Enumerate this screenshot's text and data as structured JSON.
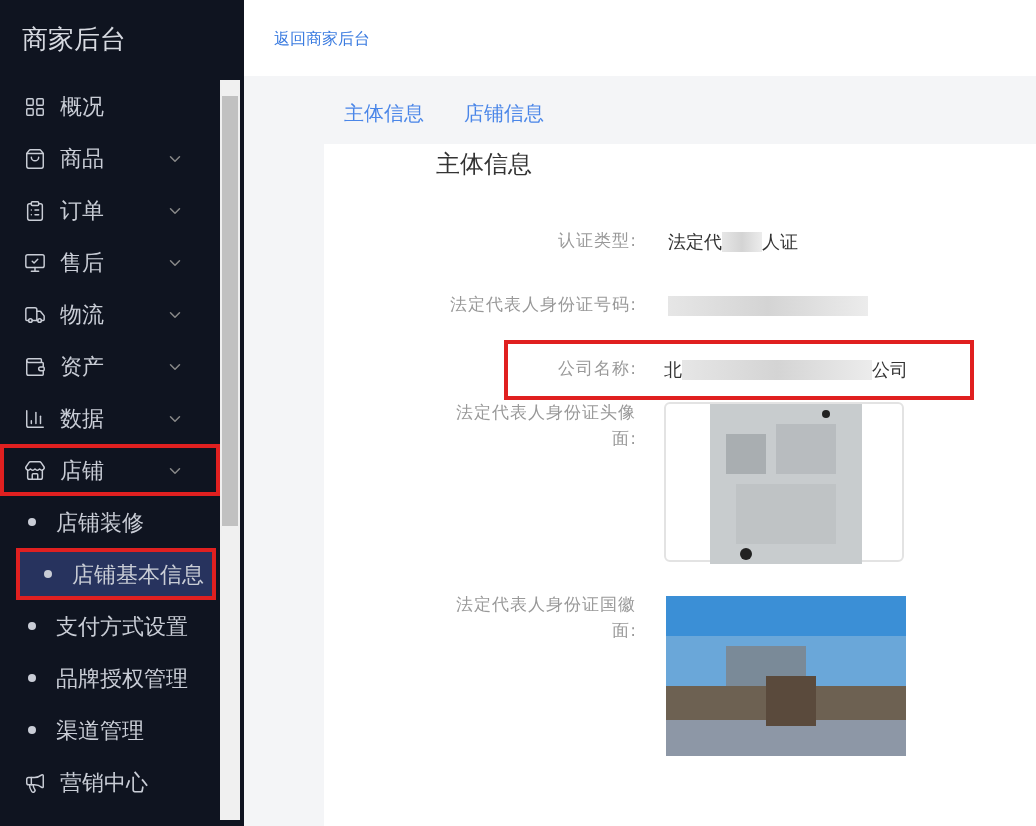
{
  "sidebar": {
    "title": "商家后台",
    "items": [
      {
        "label": "概况",
        "expandable": false,
        "highlighted": false
      },
      {
        "label": "商品",
        "expandable": true,
        "highlighted": false
      },
      {
        "label": "订单",
        "expandable": true,
        "highlighted": false
      },
      {
        "label": "售后",
        "expandable": true,
        "highlighted": false
      },
      {
        "label": "物流",
        "expandable": true,
        "highlighted": false
      },
      {
        "label": "资产",
        "expandable": true,
        "highlighted": false
      },
      {
        "label": "数据",
        "expandable": true,
        "highlighted": false
      },
      {
        "label": "店铺",
        "expandable": true,
        "highlighted": true,
        "children": [
          {
            "label": "店铺装修",
            "selected": false,
            "highlighted": false
          },
          {
            "label": "店铺基本信息",
            "selected": true,
            "highlighted": true
          },
          {
            "label": "支付方式设置",
            "selected": false,
            "highlighted": false
          },
          {
            "label": "品牌授权管理",
            "selected": false,
            "highlighted": false
          },
          {
            "label": "渠道管理",
            "selected": false,
            "highlighted": false
          }
        ]
      },
      {
        "label": "营销中心",
        "expandable": false,
        "highlighted": false
      }
    ]
  },
  "header": {
    "back_link": "返回商家后台"
  },
  "tabs": [
    {
      "label": "主体信息",
      "selected": false
    },
    {
      "label": "店铺信息",
      "selected": false
    }
  ],
  "card": {
    "title": "主体信息",
    "fields": [
      {
        "kind": "text",
        "label": "认证类型:",
        "value_parts": [
          "法定代",
          "人证"
        ],
        "highlighted": false
      },
      {
        "kind": "text",
        "label": "法定代表人身份证号码:",
        "highlighted": false
      },
      {
        "kind": "text",
        "label": "公司名称:",
        "value_parts": [
          "北",
          "公司"
        ],
        "highlighted": true
      },
      {
        "label": "法定代表人身份证头像面:",
        "framed": true
      },
      {
        "label": "法定代表人身份证国徽面:",
        "framed": false
      }
    ]
  }
}
